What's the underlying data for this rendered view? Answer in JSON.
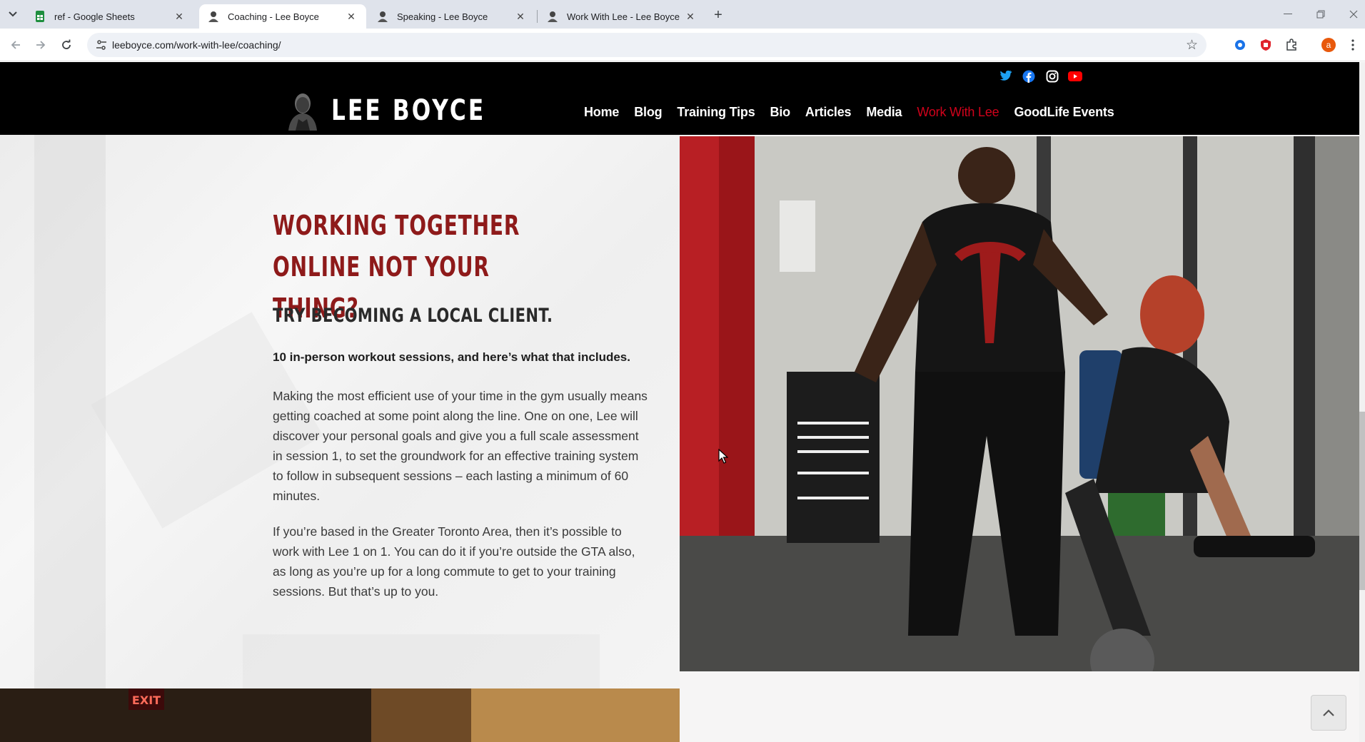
{
  "browser": {
    "tabs": [
      {
        "label": "ref - Google Sheets",
        "active": false,
        "favicon": "google-sheets-icon"
      },
      {
        "label": "Coaching - Lee Boyce",
        "active": true,
        "favicon": "lee-boyce-favicon"
      },
      {
        "label": "Speaking - Lee Boyce",
        "active": false,
        "favicon": "lee-boyce-favicon"
      },
      {
        "label": "Work With Lee - Lee Boyce",
        "active": false,
        "favicon": "lee-boyce-favicon"
      }
    ],
    "url": "leeboyce.com/work-with-lee/coaching/",
    "profile_initial": "a"
  },
  "site": {
    "logo_text": "LEE BOYCE",
    "nav": [
      {
        "label": "Home",
        "active": false
      },
      {
        "label": "Blog",
        "active": false
      },
      {
        "label": "Training Tips",
        "active": false
      },
      {
        "label": "Bio",
        "active": false
      },
      {
        "label": "Articles",
        "active": false
      },
      {
        "label": "Media",
        "active": false
      },
      {
        "label": "Work With Lee",
        "active": true
      },
      {
        "label": "GoodLife Events",
        "active": false
      }
    ],
    "social": [
      "twitter-icon",
      "facebook-icon",
      "instagram-icon",
      "youtube-icon"
    ],
    "accent_color": "#d0021b"
  },
  "content": {
    "heading": "Working together online not your thing?",
    "subheading": "Try becoming a local client.",
    "lead": "10 in-person workout sessions, and here’s what that includes.",
    "paragraph1": "Making the most efficient use of your time in the gym usually means getting coached at some point along the line. One on one, Lee will discover your personal goals and give you a full scale assessment in session 1, to set the groundwork for an effective training system to follow in subsequent sessions – each lasting a minimum of 60 minutes.",
    "paragraph2": "If you’re based in the Greater Toronto Area, then it’s possible to work with Lee 1 on 1. You can do it if you’re outside the GTA also, as long as you’re up for a long commute to get to your training sessions. But that’s up to you."
  },
  "bottom_photo_sign": "EXIT"
}
